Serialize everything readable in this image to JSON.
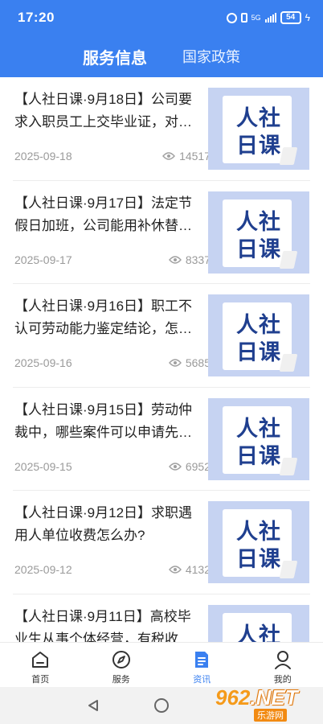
{
  "status_bar": {
    "time": "17:20",
    "network": "5G",
    "battery": "54"
  },
  "header": {
    "tabs": [
      {
        "label": "服务信息",
        "active": true
      },
      {
        "label": "国家政策",
        "active": false
      }
    ]
  },
  "thumbnail": {
    "line1": "人社",
    "line2": "日课"
  },
  "articles": [
    {
      "title": "【人社日课·9月18日】公司要求入职员工上交毕业证，对…",
      "date": "2025-09-18",
      "views": "14517"
    },
    {
      "title": "【人社日课·9月17日】法定节假日加班，公司能用补休替…",
      "date": "2025-09-17",
      "views": "8337"
    },
    {
      "title": "【人社日课·9月16日】职工不认可劳动能力鉴定结论，怎…",
      "date": "2025-09-16",
      "views": "5685"
    },
    {
      "title": "【人社日课·9月15日】劳动仲裁中，哪些案件可以申请先…",
      "date": "2025-09-15",
      "views": "6952"
    },
    {
      "title": "【人社日课·9月12日】求职遇用人单位收费怎么办?",
      "date": "2025-09-12",
      "views": "4132"
    },
    {
      "title": "【人社日课·9月11日】高校毕业生从事个体经营，有税收…",
      "date": "",
      "views": ""
    }
  ],
  "bottom_nav": [
    {
      "label": "首页",
      "icon": "home-icon"
    },
    {
      "label": "服务",
      "icon": "compass-icon"
    },
    {
      "label": "资讯",
      "icon": "news-icon",
      "active": true
    },
    {
      "label": "我的",
      "icon": "user-icon"
    }
  ],
  "watermark": {
    "top": "962.NET",
    "bottom": "乐游网"
  },
  "colors": {
    "primary": "#3a80f0",
    "thumb_bg": "#c6d3f2",
    "thumb_text": "#1f3f8f"
  }
}
